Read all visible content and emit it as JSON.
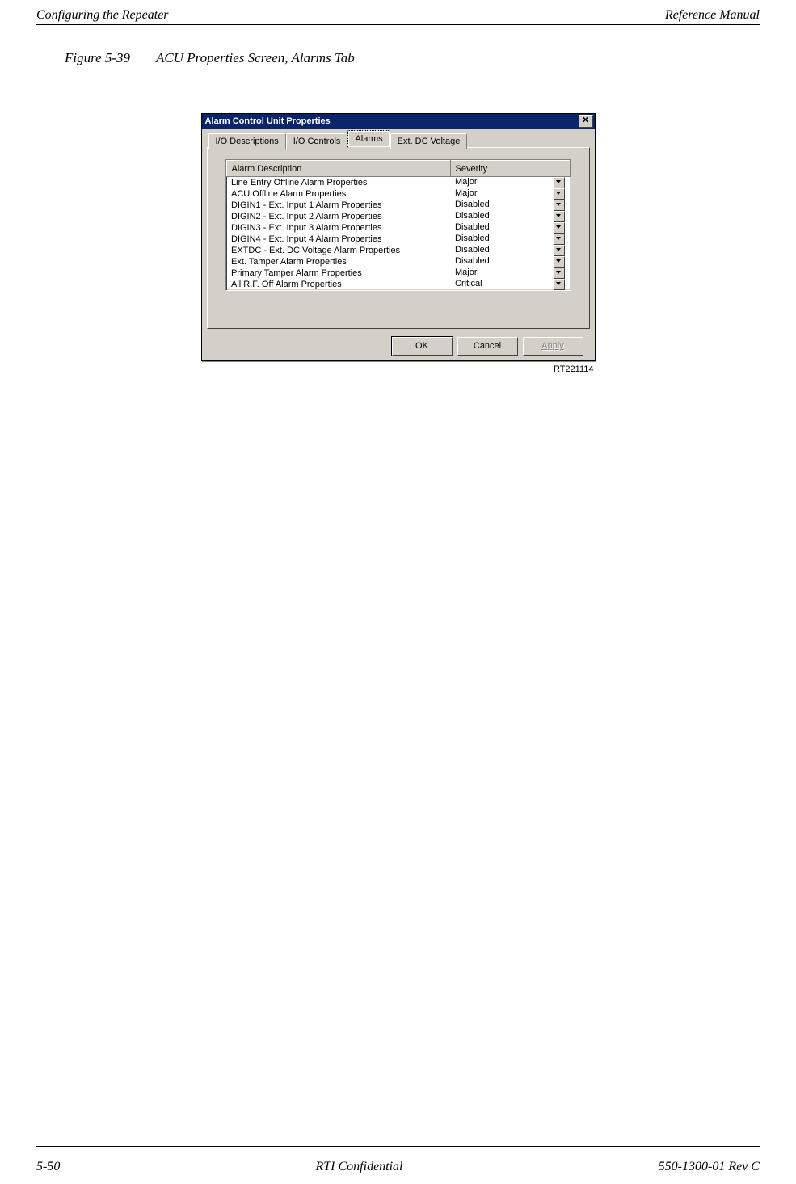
{
  "header": {
    "left": "Configuring the Repeater",
    "right": "Reference Manual"
  },
  "figure": {
    "number": "Figure 5-39",
    "title": "ACU Properties Screen, Alarms Tab",
    "ref": "RT221114"
  },
  "dialog": {
    "title": "Alarm Control Unit Properties",
    "tabs": {
      "io_desc": "I/O Descriptions",
      "io_ctrl": "I/O Controls",
      "alarms": "Alarms",
      "ext_dc": "Ext. DC Voltage"
    },
    "columns": {
      "desc": "Alarm Description",
      "sev": "Severity"
    },
    "alarms": [
      {
        "desc": "Line Entry Offline Alarm Properties",
        "sev": "Major"
      },
      {
        "desc": "ACU Offline Alarm Properties",
        "sev": "Major"
      },
      {
        "desc": "DIGIN1 - Ext. Input 1 Alarm Properties",
        "sev": "Disabled"
      },
      {
        "desc": "DIGIN2 - Ext. Input 2 Alarm Properties",
        "sev": "Disabled"
      },
      {
        "desc": "DIGIN3 - Ext. Input 3 Alarm Properties",
        "sev": "Disabled"
      },
      {
        "desc": "DIGIN4 - Ext. Input 4 Alarm Properties",
        "sev": "Disabled"
      },
      {
        "desc": "EXTDC - Ext. DC Voltage Alarm Properties",
        "sev": "Disabled"
      },
      {
        "desc": "Ext. Tamper Alarm Properties",
        "sev": "Disabled"
      },
      {
        "desc": "Primary Tamper Alarm Properties",
        "sev": "Major"
      },
      {
        "desc": "All R.F. Off Alarm Properties",
        "sev": "Critical"
      }
    ],
    "buttons": {
      "ok": "OK",
      "cancel": "Cancel",
      "apply": "Apply"
    }
  },
  "footer": {
    "left": "5-50",
    "center": "RTI Confidential",
    "right": "550-1300-01 Rev C"
  }
}
